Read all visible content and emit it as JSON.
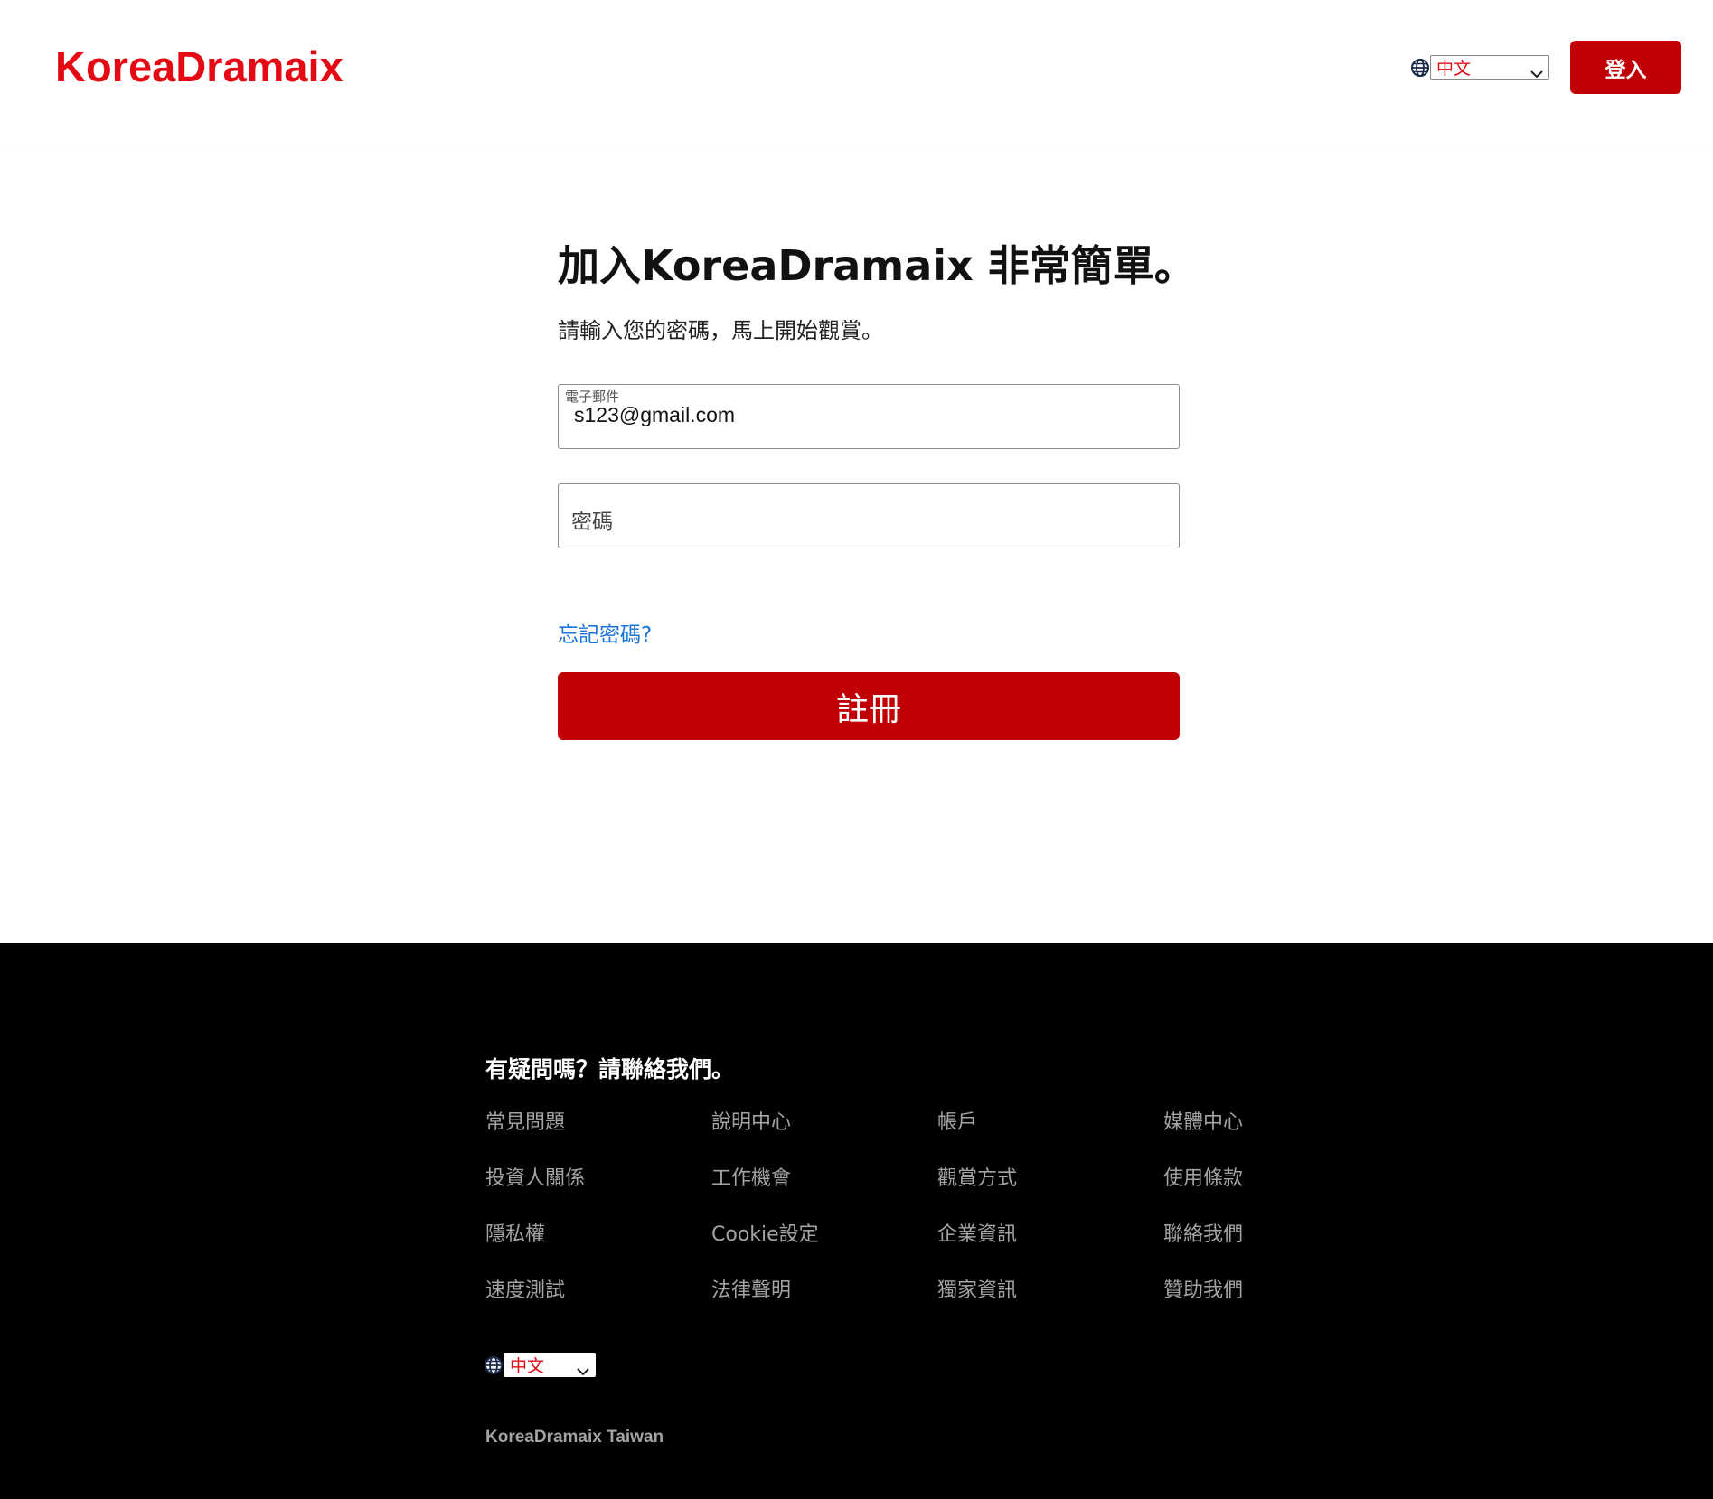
{
  "header": {
    "logo": "KoreaDramaix",
    "language": "中文",
    "login_label": "登入"
  },
  "main": {
    "title": "加入KoreaDramaix 非常簡單。",
    "subtitle": "請輸入您的密碼，馬上開始觀賞。",
    "email_label": "電子郵件",
    "email_value": "s123@gmail.com",
    "password_placeholder": "密碼",
    "forgot_label": "忘記密碼?",
    "signup_label": "註冊"
  },
  "footer": {
    "heading": "有疑問嗎？請聯絡我們。",
    "links": [
      [
        "常見問題",
        "說明中心",
        "帳戶",
        "媒體中心"
      ],
      [
        "投資人關係",
        "工作機會",
        "觀賞方式",
        "使用條款"
      ],
      [
        "隱私權",
        "Cookie設定",
        "企業資訊",
        "聯絡我們"
      ],
      [
        "速度測試",
        "法律聲明",
        "獨家資訊",
        "贊助我們"
      ]
    ],
    "language": "中文",
    "company": "KoreaDramaix Taiwan"
  },
  "colors": {
    "brand_red": "#e50914",
    "button_red": "#c10005",
    "link_blue": "#1a73d9",
    "footer_bg": "#000000",
    "footer_text": "#a3a3a3"
  },
  "icons": {
    "globe": "globe-icon",
    "dropdown": "chevron-down-icon"
  }
}
